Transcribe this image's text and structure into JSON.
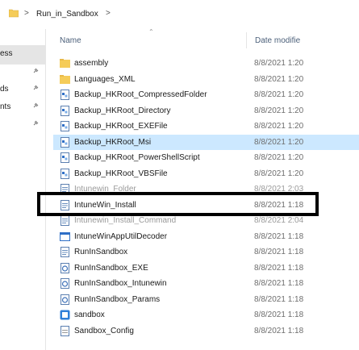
{
  "address": {
    "crumb": "Run_in_Sandbox",
    "sep": ">"
  },
  "nav": {
    "items": [
      "ess",
      "ds",
      "nts"
    ]
  },
  "columns": {
    "name": "Name",
    "date": "Date modifie"
  },
  "files": [
    {
      "name": "assembly",
      "date": "8/8/2021 1:20",
      "icon": "folder-icon"
    },
    {
      "name": "Languages_XML",
      "date": "8/8/2021 1:20",
      "icon": "folder-icon"
    },
    {
      "name": "Backup_HKRoot_CompressedFolder",
      "date": "8/8/2021 1:20",
      "icon": "registry-file-icon"
    },
    {
      "name": "Backup_HKRoot_Directory",
      "date": "8/8/2021 1:20",
      "icon": "registry-file-icon"
    },
    {
      "name": "Backup_HKRoot_EXEFile",
      "date": "8/8/2021 1:20",
      "icon": "registry-file-icon"
    },
    {
      "name": "Backup_HKRoot_Msi",
      "date": "8/8/2021 1:20",
      "icon": "registry-file-icon"
    },
    {
      "name": "Backup_HKRoot_PowerShellScript",
      "date": "8/8/2021 1:20",
      "icon": "registry-file-icon"
    },
    {
      "name": "Backup_HKRoot_VBSFile",
      "date": "8/8/2021 1:20",
      "icon": "registry-file-icon"
    },
    {
      "name": "Intunewin_Folder",
      "date": "8/8/2021 2:03",
      "icon": "script-file-icon"
    },
    {
      "name": "IntuneWin_Install",
      "date": "8/8/2021 1:18",
      "icon": "script-file-icon"
    },
    {
      "name": "Intunewin_Install_Command",
      "date": "8/8/2021 2:04",
      "icon": "script-file-icon"
    },
    {
      "name": "IntuneWinAppUtilDecoder",
      "date": "8/8/2021 1:18",
      "icon": "application-icon"
    },
    {
      "name": "RunInSandbox",
      "date": "8/8/2021 1:18",
      "icon": "script-file-icon"
    },
    {
      "name": "RunInSandbox_EXE",
      "date": "8/8/2021 1:18",
      "icon": "powershell-file-icon"
    },
    {
      "name": "RunInSandbox_Intunewin",
      "date": "8/8/2021 1:18",
      "icon": "powershell-file-icon"
    },
    {
      "name": "RunInSandbox_Params",
      "date": "8/8/2021 1:18",
      "icon": "powershell-file-icon"
    },
    {
      "name": "sandbox",
      "date": "8/8/2021 1:18",
      "icon": "sandbox-icon"
    },
    {
      "name": "Sandbox_Config",
      "date": "8/8/2021 1:18",
      "icon": "config-file-icon"
    }
  ],
  "colors": {
    "selected": "#cce8ff",
    "folder": "#f5cc59",
    "highlight_border": "#000000"
  }
}
